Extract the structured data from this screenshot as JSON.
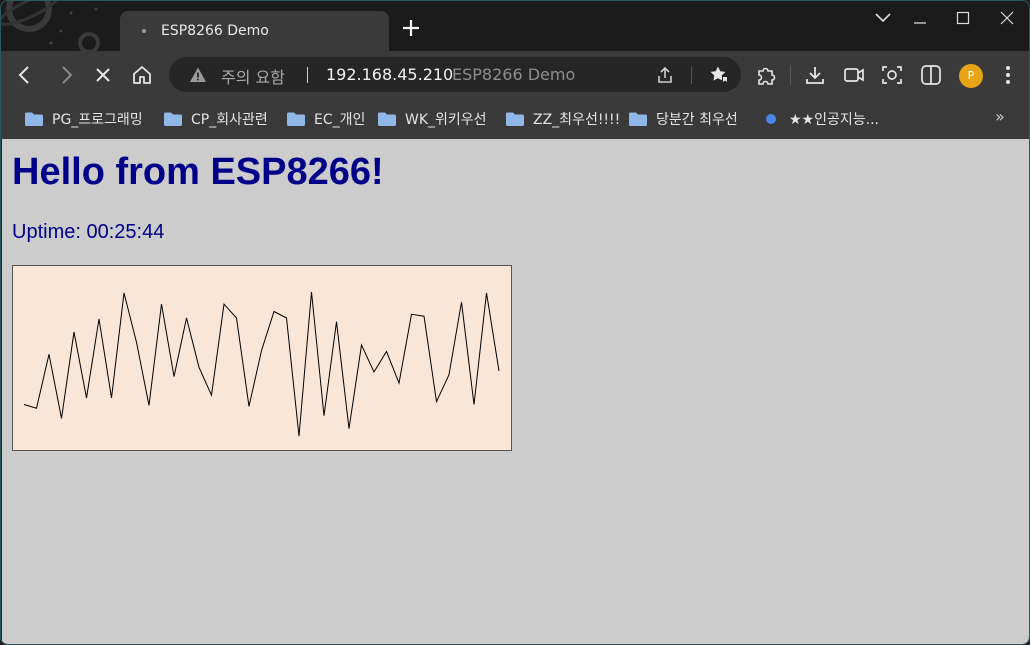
{
  "tab": {
    "title": "ESP8266 Demo"
  },
  "omnibox": {
    "security_text": "주의 요함",
    "url": "192.168.45.210",
    "page_title": "ESP8266 Demo"
  },
  "profile": {
    "initial": "P"
  },
  "bookmarks": [
    {
      "label": "PG_프로그래밍",
      "type": "folder"
    },
    {
      "label": "CP_회사관련",
      "type": "folder"
    },
    {
      "label": "EC_개인",
      "type": "folder"
    },
    {
      "label": "WK_위키우선",
      "type": "folder"
    },
    {
      "label": "ZZ_최우선!!!!",
      "type": "folder"
    },
    {
      "label": "당분간 최우선",
      "type": "folder"
    },
    {
      "label": "★★인공지능...",
      "type": "link"
    }
  ],
  "bookmarks_overflow": "»",
  "page": {
    "heading": "Hello from ESP8266!",
    "uptime_label": "Uptime:",
    "uptime_value": "00:25:44"
  },
  "colors": {
    "heading": "#000088",
    "page_bg": "#cccccc",
    "chart_bg": "#fae6d6",
    "line": "#000000"
  },
  "chart_data": {
    "type": "line",
    "title": "",
    "xlabel": "",
    "ylabel": "",
    "grid": false,
    "ylim": [
      0,
      200
    ],
    "series": [
      {
        "values": [
          50,
          46,
          104,
          35,
          128,
          57,
          142,
          57,
          170,
          117,
          49,
          158,
          80,
          143,
          90,
          60,
          158,
          143,
          48,
          108,
          150,
          143,
          16,
          171,
          38,
          139,
          24,
          114,
          85,
          107,
          73,
          147,
          145,
          53,
          82,
          160,
          50,
          170,
          86
        ]
      }
    ]
  }
}
